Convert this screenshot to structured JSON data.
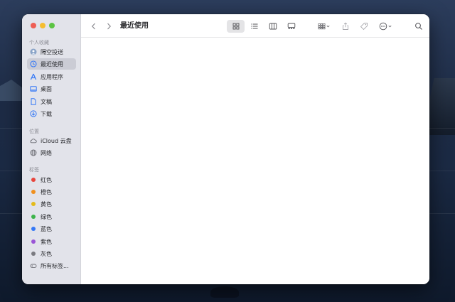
{
  "window": {
    "title": "最近使用"
  },
  "sidebar": {
    "favorites_title": "个人收藏",
    "favorites": [
      {
        "label": "隔空投送",
        "icon": "airdrop-icon"
      },
      {
        "label": "最近使用",
        "icon": "clock-icon",
        "selected": true
      },
      {
        "label": "应用程序",
        "icon": "apps-icon"
      },
      {
        "label": "桌面",
        "icon": "desktop-icon"
      },
      {
        "label": "文稿",
        "icon": "document-icon"
      },
      {
        "label": "下载",
        "icon": "download-icon"
      }
    ],
    "locations_title": "位置",
    "locations": [
      {
        "label": "iCloud 云盘",
        "icon": "cloud-icon"
      },
      {
        "label": "网络",
        "icon": "globe-icon"
      }
    ],
    "tags_title": "标签",
    "tags": [
      {
        "label": "红色",
        "color": "#e8453c"
      },
      {
        "label": "橙色",
        "color": "#f0901e"
      },
      {
        "label": "黄色",
        "color": "#e4bb1a"
      },
      {
        "label": "绿色",
        "color": "#3cb34a"
      },
      {
        "label": "蓝色",
        "color": "#3478f6"
      },
      {
        "label": "紫色",
        "color": "#9a55d6"
      },
      {
        "label": "灰色",
        "color": "#7a7a80"
      }
    ],
    "all_tags": "所有标签..."
  },
  "colors": {
    "accent": "#3478f6",
    "sidebar_bg": "#e2e3ea",
    "selected_bg": "#cbccd5"
  }
}
